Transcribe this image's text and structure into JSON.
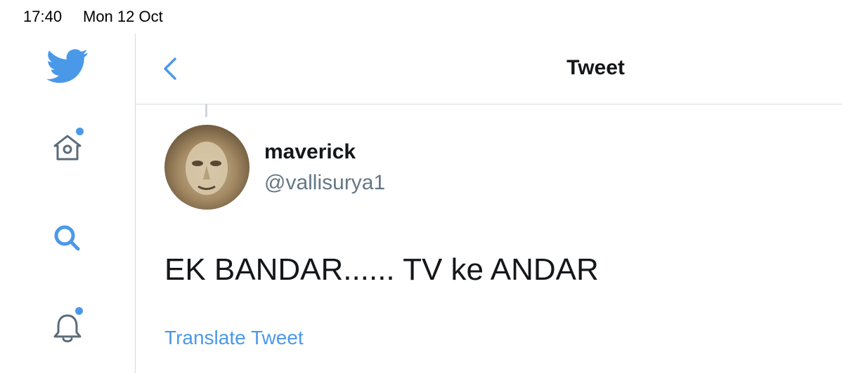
{
  "status_bar": {
    "time": "17:40",
    "date": "Mon 12 Oct"
  },
  "sidebar": {
    "items": [
      {
        "icon": "twitter-bird-icon",
        "badge": false
      },
      {
        "icon": "home-icon",
        "badge": true
      },
      {
        "icon": "search-icon",
        "badge": false
      },
      {
        "icon": "notifications-bell-icon",
        "badge": true
      }
    ]
  },
  "header": {
    "title": "Tweet",
    "back_icon": "chevron-left-icon"
  },
  "tweet": {
    "display_name": "maverick",
    "handle": "@vallisurya1",
    "text": "EK BANDAR...... TV ke ANDAR",
    "translate_label": "Translate Tweet"
  },
  "colors": {
    "accent": "#4a99e9",
    "text": "#14171a",
    "secondary": "#657786",
    "divider": "#d6d9dc"
  }
}
